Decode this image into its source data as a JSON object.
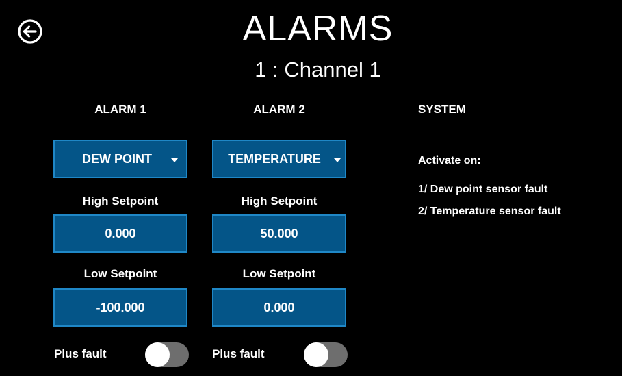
{
  "header": {
    "title": "ALARMS",
    "subtitle": "1 : Channel 1",
    "back_icon": "back-arrow-circle-icon"
  },
  "alarm1": {
    "heading": "ALARM 1",
    "type_value": "DEW POINT",
    "high_label": "High Setpoint",
    "high_value": "0.000",
    "low_label": "Low Setpoint",
    "low_value": "-100.000",
    "plus_fault_label": "Plus fault",
    "plus_fault_on": false
  },
  "alarm2": {
    "heading": "ALARM 2",
    "type_value": "TEMPERATURE",
    "high_label": "High Setpoint",
    "high_value": "50.000",
    "low_label": "Low Setpoint",
    "low_value": "0.000",
    "plus_fault_label": "Plus fault",
    "plus_fault_on": false
  },
  "system": {
    "heading": "SYSTEM",
    "activate_label": "Activate on:",
    "items": [
      "1/ Dew point sensor fault",
      "2/ Temperature sensor fault"
    ]
  },
  "colors": {
    "background": "#000000",
    "field_fill": "#045588",
    "field_border": "#1f87c6",
    "toggle_track": "#6e6e6e",
    "toggle_knob": "#ffffff"
  }
}
